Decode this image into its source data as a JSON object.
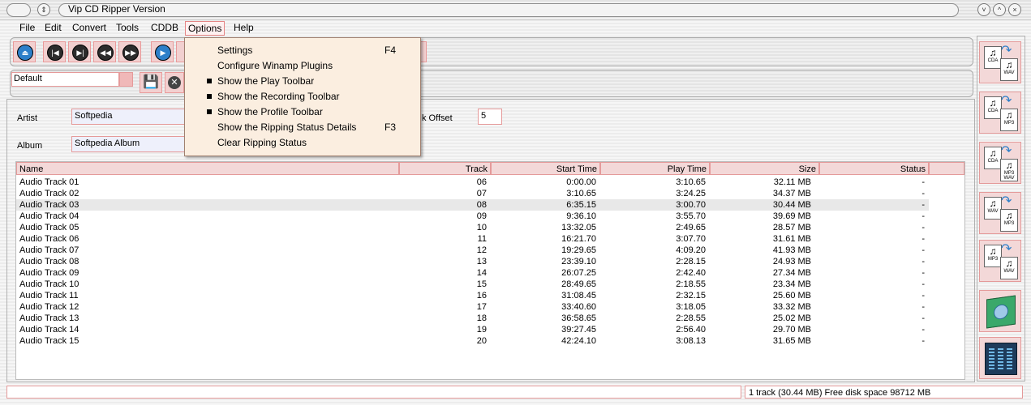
{
  "window": {
    "title": "Vip CD Ripper Version"
  },
  "menu": {
    "file": "File",
    "edit": "Edit",
    "convert": "Convert",
    "tools": "Tools",
    "cddb": "CDDB",
    "options": "Options",
    "help": "Help"
  },
  "options_menu": [
    {
      "label": "Settings",
      "shortcut": "F4",
      "checked": false
    },
    {
      "label": "Configure Winamp Plugins",
      "shortcut": "",
      "checked": false
    },
    {
      "label": "Show the Play Toolbar",
      "shortcut": "",
      "checked": true
    },
    {
      "label": "Show the Recording Toolbar",
      "shortcut": "",
      "checked": true
    },
    {
      "label": "Show the Profile Toolbar",
      "shortcut": "",
      "checked": true
    },
    {
      "label": "Show the Ripping Status Details",
      "shortcut": "F3",
      "checked": false
    },
    {
      "label": "Clear Ripping Status",
      "shortcut": "",
      "checked": false
    }
  ],
  "profile": {
    "value": "Default"
  },
  "info": {
    "artist_label": "Artist",
    "artist_value": "Softpedia",
    "album_label": "Album",
    "album_value": "Softpedia Album",
    "offset_label": "k Offset",
    "offset_value": "5"
  },
  "table": {
    "headers": {
      "name": "Name",
      "track": "Track",
      "start": "Start Time",
      "play": "Play Time",
      "size": "Size",
      "status": "Status"
    },
    "rows": [
      {
        "name": "Audio Track 01",
        "track": "06",
        "start": "0:00.00",
        "play": "3:10.65",
        "size": "32.11 MB",
        "status": "-"
      },
      {
        "name": "Audio Track 02",
        "track": "07",
        "start": "3:10.65",
        "play": "3:24.25",
        "size": "34.37 MB",
        "status": "-"
      },
      {
        "name": "Audio Track 03",
        "track": "08",
        "start": "6:35.15",
        "play": "3:00.70",
        "size": "30.44 MB",
        "status": "-"
      },
      {
        "name": "Audio Track 04",
        "track": "09",
        "start": "9:36.10",
        "play": "3:55.70",
        "size": "39.69 MB",
        "status": "-"
      },
      {
        "name": "Audio Track 05",
        "track": "10",
        "start": "13:32.05",
        "play": "2:49.65",
        "size": "28.57 MB",
        "status": "-"
      },
      {
        "name": "Audio Track 06",
        "track": "11",
        "start": "16:21.70",
        "play": "3:07.70",
        "size": "31.61 MB",
        "status": "-"
      },
      {
        "name": "Audio Track 07",
        "track": "12",
        "start": "19:29.65",
        "play": "4:09.20",
        "size": "41.93 MB",
        "status": "-"
      },
      {
        "name": "Audio Track 08",
        "track": "13",
        "start": "23:39.10",
        "play": "2:28.15",
        "size": "24.93 MB",
        "status": "-"
      },
      {
        "name": "Audio Track 09",
        "track": "14",
        "start": "26:07.25",
        "play": "2:42.40",
        "size": "27.34 MB",
        "status": "-"
      },
      {
        "name": "Audio Track 10",
        "track": "15",
        "start": "28:49.65",
        "play": "2:18.55",
        "size": "23.34 MB",
        "status": "-"
      },
      {
        "name": "Audio Track 11",
        "track": "16",
        "start": "31:08.45",
        "play": "2:32.15",
        "size": "25.60 MB",
        "status": "-"
      },
      {
        "name": "Audio Track 12",
        "track": "17",
        "start": "33:40.60",
        "play": "3:18.05",
        "size": "33.32 MB",
        "status": "-"
      },
      {
        "name": "Audio Track 13",
        "track": "18",
        "start": "36:58.65",
        "play": "2:28.55",
        "size": "25.02 MB",
        "status": "-"
      },
      {
        "name": "Audio Track 14",
        "track": "19",
        "start": "39:27.45",
        "play": "2:56.40",
        "size": "29.70 MB",
        "status": "-"
      },
      {
        "name": "Audio Track 15",
        "track": "20",
        "start": "42:24.10",
        "play": "3:08.13",
        "size": "31.65 MB",
        "status": "-"
      }
    ],
    "selected_row": "Audio Track 03"
  },
  "right_panel": [
    {
      "from": "CDA",
      "to": "WAV"
    },
    {
      "from": "CDA",
      "to": "MP3"
    },
    {
      "from": "CDA",
      "to": "MP3 WAV"
    },
    {
      "from": "WAV",
      "to": "MP3"
    },
    {
      "from": "MP3",
      "to": "WAV"
    }
  ],
  "status": {
    "left": "",
    "right": "1 track (30.44 MB) Free disk space 98712 MB"
  },
  "colors": {
    "accent": "#e59a9a",
    "menu_bg": "#fbeee0",
    "selection": "#e8e8e8"
  }
}
